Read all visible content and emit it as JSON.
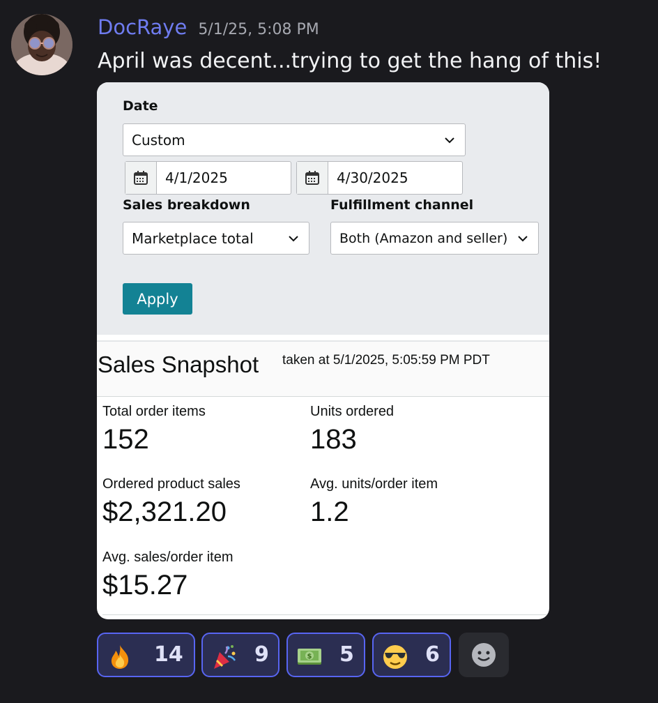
{
  "message": {
    "username": "DocRaye",
    "timestamp": "5/1/25, 5:08 PM",
    "text": "April was decent...trying to get the hang of this!"
  },
  "filters": {
    "date_label": "Date",
    "date_range_value": "Custom",
    "start_date": "4/1/2025",
    "end_date": "4/30/2025",
    "sales_breakdown_label": "Sales breakdown",
    "sales_breakdown_value": "Marketplace total",
    "fulfillment_label": "Fulfillment channel",
    "fulfillment_value": "Both (Amazon and seller)",
    "apply_label": "Apply"
  },
  "snapshot": {
    "title": "Sales Snapshot",
    "taken": "taken at 5/1/2025, 5:05:59 PM PDT",
    "metrics": [
      {
        "label": "Total order items",
        "value": "152"
      },
      {
        "label": "Units ordered",
        "value": "183"
      },
      {
        "label": "Ordered product sales",
        "value": "$2,321.20"
      },
      {
        "label": "Avg. units/order item",
        "value": "1.2"
      },
      {
        "label": "Avg. sales/order item",
        "value": "$15.27"
      }
    ]
  },
  "reactions": [
    {
      "icon": "fire-emoji-icon",
      "count": "14"
    },
    {
      "icon": "party-popper-emoji-icon",
      "count": "9"
    },
    {
      "icon": "dollar-banknote-emoji-icon",
      "count": "5"
    },
    {
      "icon": "sunglasses-face-emoji-icon",
      "count": "6"
    }
  ],
  "colors": {
    "background": "#1a1a1e",
    "username": "#6f7cf0",
    "apply_button": "#138294",
    "reaction_border": "#5865f2",
    "reaction_bg": "#2b2e52"
  }
}
